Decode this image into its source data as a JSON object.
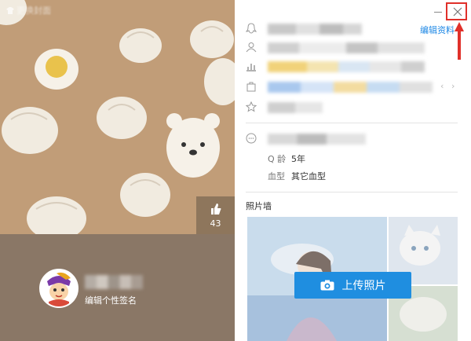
{
  "left": {
    "skin_label": "更换封面",
    "likes": "43",
    "signature": "编辑个性签名"
  },
  "header": {
    "edit_profile": "编辑资料"
  },
  "profile": {
    "qq_age_label": "Q 龄",
    "qq_age_value": "5年",
    "blood_label": "血型",
    "blood_value": "其它血型"
  },
  "photos": {
    "title": "照片墙",
    "upload_label": "上传照片"
  },
  "colors": {
    "accent": "#1f8ee0",
    "highlight": "#e0302a",
    "cover": "#c19d78"
  },
  "icons": [
    "qq-penguin-icon",
    "user-icon",
    "chart-icon",
    "bag-icon",
    "star-icon",
    "chat-icon",
    "thumb-up-icon",
    "camera-icon",
    "close-icon",
    "minimize-icon",
    "arrow-up-icon"
  ]
}
